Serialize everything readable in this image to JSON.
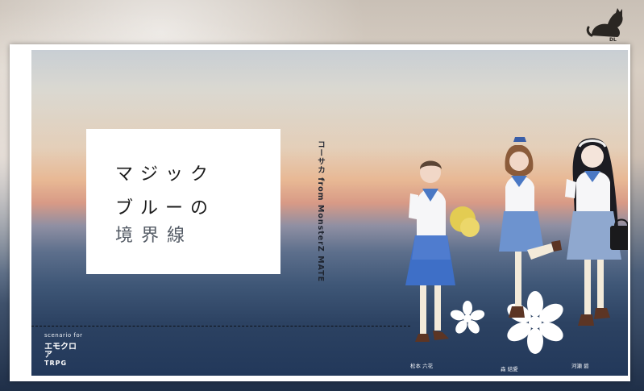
{
  "logo": {
    "text": "DL",
    "icon": "cat-icon"
  },
  "title": {
    "line1": "マジック",
    "line2": "ブルーの",
    "line3": "境界線"
  },
  "author": "コーサカ from MonsterZ MATE",
  "scenario_for": "scenario for",
  "brand": {
    "line1": "エモクロア",
    "line2": "TRPG"
  },
  "characters": [
    {
      "name": "松本 六花"
    },
    {
      "name": "森 結愛"
    },
    {
      "name": "河瀬 碧"
    }
  ],
  "colors": {
    "sky_top": "#d6d4cc",
    "sunset": "#e8b894",
    "sea": "#22385a",
    "card": "#ffffff",
    "uniform_blue": "#4a78c4"
  }
}
